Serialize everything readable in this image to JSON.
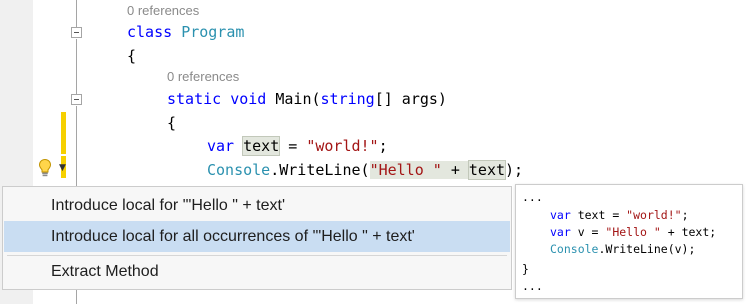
{
  "editor": {
    "codelens_class": "0 references",
    "codelens_main": "0 references",
    "line_class_kw": "class",
    "line_class_name": "Program",
    "open_brace": "{",
    "main_static": "static",
    "main_void": "void",
    "main_name": "Main(",
    "main_string": "string",
    "main_rest": "[] args)",
    "var_kw": "var",
    "var_name": "text",
    "var_assign": " = ",
    "var_value": "\"world!\"",
    "var_end": ";",
    "console_type": "Console",
    "console_call": ".WriteLine(",
    "console_str": "\"Hello \"",
    "console_plus": " + ",
    "console_arg": "text",
    "console_end": ");"
  },
  "lightbulb": {
    "icon": "lightbulb-icon",
    "dropdown_icon": "chevron-down-icon"
  },
  "menu": {
    "items": [
      {
        "label": "Introduce local for '\"Hello \" + text'",
        "selected": false
      },
      {
        "label": "Introduce local for all occurrences of '\"Hello \" + text'",
        "selected": true
      },
      {
        "label": "Extract Method",
        "selected": false
      }
    ]
  },
  "preview": {
    "ellipsis_top": "...",
    "l1_kw": "var",
    "l1_rest": " text = ",
    "l1_str": "\"world!\"",
    "l1_end": ";",
    "l2_kw": "var",
    "l2_rest": " v = ",
    "l2_str": "\"Hello \"",
    "l2_end": " + text;",
    "l3_type": "Console",
    "l3_rest": ".WriteLine(v);",
    "close_brace": "}",
    "ellipsis_bottom": "..."
  },
  "colors": {
    "keyword": "#0000ff",
    "type": "#2b91af",
    "string": "#a31515",
    "selection": "#c9ddf2",
    "change_bar": "#f6d000"
  }
}
